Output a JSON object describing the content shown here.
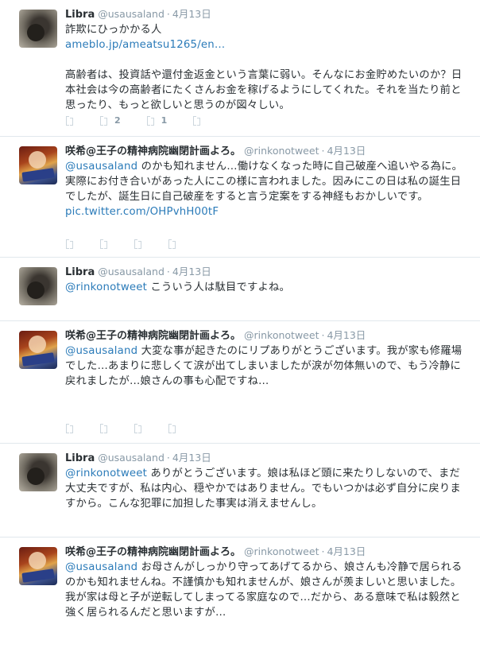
{
  "tweets": [
    {
      "name": "Libra",
      "handle": "@usausaland",
      "time": "4月13日",
      "lines": [
        "詐欺にひっかかる人"
      ],
      "link": "ameblo.jp/ameatsu1265/en…",
      "body": "高齢者は、投資話や還付金返金という言葉に弱い。そんなにお金貯めたいのか？日本社会は今の高齢者にたくさんお金を稼げるようにしてくれた。それを当たり前と思ったり、もっと欲しいと思うのが図々しい。",
      "retweet_count": "2",
      "favorite_count": "1"
    },
    {
      "name": "咲希@王子の精神病院幽閉計画よろ。",
      "handle": "@rinkonotweet",
      "time": "4月13日",
      "mention": "@usausaland",
      "body": " のかも知れません…働けなくなった時に自己破産へ追いやる為に。実際にお付き合いがあった人にこの様に言われました。因みにこの日は私の誕生日でしたが、誕生日に自己破産をすると言う定案をする神経もおかしいです。",
      "pic": "pic.twitter.com/OHPvhH00tF"
    },
    {
      "name": "Libra",
      "handle": "@usausaland",
      "time": "4月13日",
      "mention": "@rinkonotweet",
      "body": " こういう人は駄目ですよね。"
    },
    {
      "name": "咲希@王子の精神病院幽閉計画よろ。",
      "handle": "@rinkonotweet",
      "time": "4月13日",
      "mention": "@usausaland",
      "body": " 大変な事が起きたのにリプありがとうございます。我が家も修羅場でした…あまりに悲しくて涙が出てしまいましたが涙が勿体無いので、もう冷静に戻れましたが…娘さんの事も心配ですね…"
    },
    {
      "name": "Libra",
      "handle": "@usausaland",
      "time": "4月13日",
      "mention": "@rinkonotweet",
      "body": " ありがとうございます。娘は私ほど頭に来たりしないので、まだ大丈夫ですが、私は内心、穏やかではありません。でもいつかは必ず自分に戻りますから。こんな犯罪に加担した事実は消えませんし。"
    },
    {
      "name": "咲希@王子の精神病院幽閉計画よろ。",
      "handle": "@rinkonotweet",
      "time": "4月13日",
      "mention": "@usausaland",
      "body": " お母さんがしっかり守ってあげてるから、娘さんも冷静で居られるのかも知れませんね。不謹慎かも知れませんが、娘さんが羨ましいと思いました。我が家は母と子が逆転してしまってる家庭なので…だから、ある意味で私は毅然と強く居られるんだと思いますが…"
    }
  ],
  "icons": {
    "action": "tweet-action-icon"
  },
  "colors": {
    "link": "#2b7bb9",
    "muted": "#8899a6",
    "divider": "#e1e8ed"
  }
}
